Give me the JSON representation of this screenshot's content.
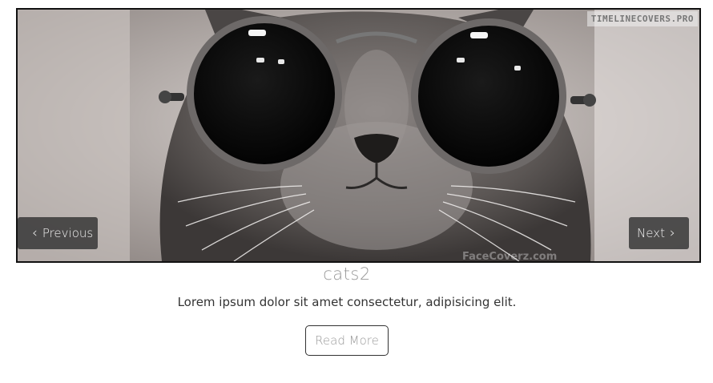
{
  "slider": {
    "watermark": "TIMELINECOVERS.PRO",
    "image_watermark": "FaceCoverz.com",
    "prev_label": "Previous",
    "next_label": "Next"
  },
  "caption": {
    "title": "cats2",
    "text": "Lorem ipsum dolor sit amet consectetur, adipisicing elit.",
    "button": "Read More"
  }
}
